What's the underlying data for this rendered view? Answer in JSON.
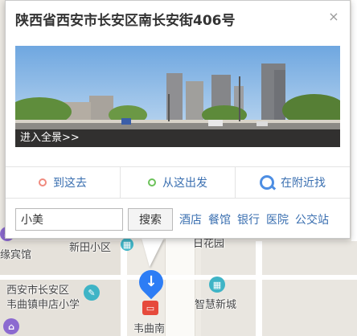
{
  "popup": {
    "title": "陕西省西安市长安区南长安街406号",
    "close_glyph": "×",
    "panorama_caption": "进入全景>>",
    "actions": [
      {
        "label": "到这去",
        "icon": "destination-circle-icon",
        "color": "#f08a7e"
      },
      {
        "label": "从这出发",
        "icon": "origin-circle-icon",
        "color": "#6cc25a"
      },
      {
        "label": "在附近找",
        "icon": "nearby-search-icon",
        "color": "#4d8ee3"
      }
    ],
    "search": {
      "value": "小美",
      "button_label": "搜索"
    },
    "quick_links": [
      "酒店",
      "餐馆",
      "银行",
      "医院",
      "公交站"
    ]
  },
  "map": {
    "labels": {
      "left_hotel": "缘宾馆",
      "xintian": "新田小区",
      "baihuayuan": "日花园",
      "school_line1": "西安市长安区",
      "school_line2": "韦曲镇申店小学",
      "smart_city": "智慧新城",
      "weiqu_south": "韦曲南"
    },
    "metro_badge_glyph": "▭"
  },
  "colors": {
    "link_blue": "#3a6fb0",
    "metro_pin": "#2d7df5",
    "metro_badge": "#e64a3c"
  }
}
